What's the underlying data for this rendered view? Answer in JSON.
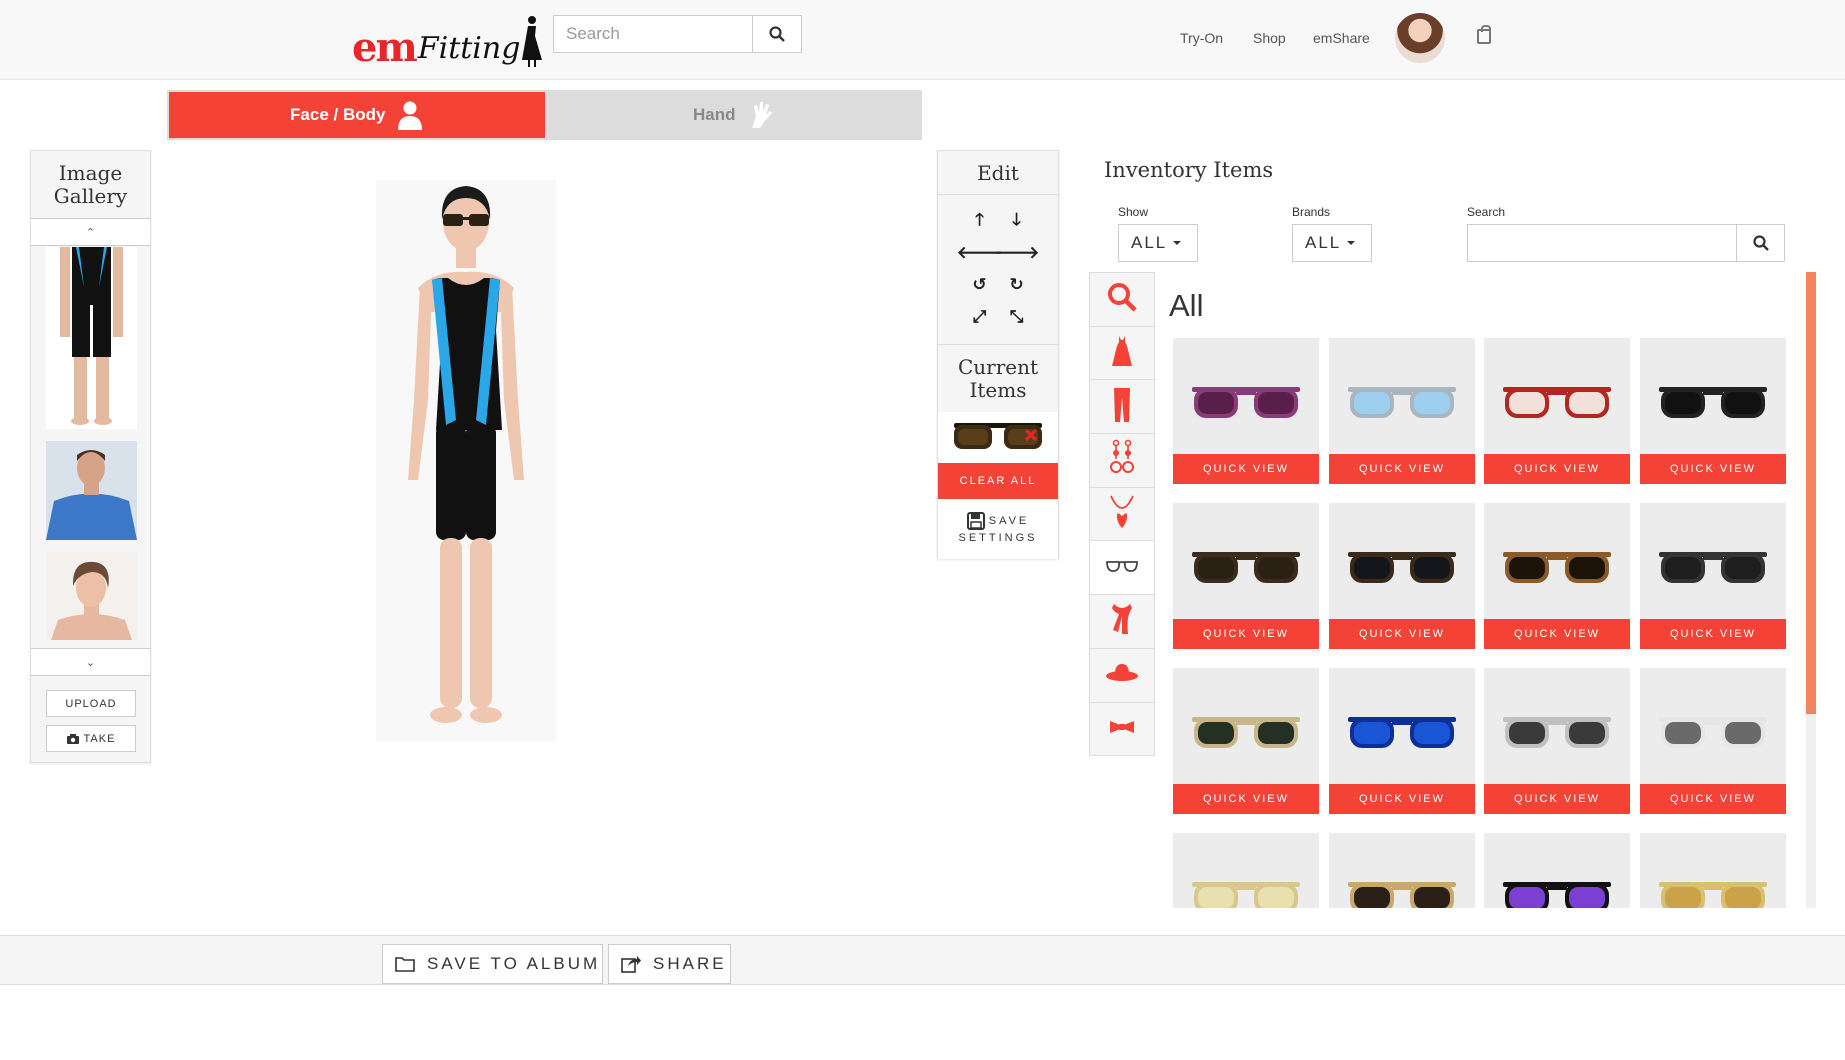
{
  "header": {
    "logo_em": "em",
    "logo_fitting": "Fitting",
    "search_placeholder": "Search",
    "nav": [
      "Try-On",
      "Shop",
      "emShare"
    ]
  },
  "mode_tabs": {
    "face_body": "Face / Body",
    "hand": "Hand",
    "active": "face_body"
  },
  "gallery": {
    "title_line1": "Image",
    "title_line2": "Gallery",
    "upload_label": "UPLOAD",
    "take_label": "TAKE"
  },
  "edit": {
    "title": "Edit",
    "current_line1": "Current",
    "current_line2": "Items",
    "clear_all": "CLEAR ALL",
    "save_line1": "SAVE",
    "save_line2": "SETTINGS"
  },
  "inventory": {
    "title": "Inventory Items",
    "show_label": "Show",
    "show_value": "ALL",
    "brands_label": "Brands",
    "brands_value": "ALL",
    "search_label": "Search",
    "heading": "All",
    "quick_view": "QUICK VIEW",
    "categories": [
      "search-icon",
      "dress-icon",
      "pants-icon",
      "earrings-icon",
      "necklace-icon",
      "glasses-icon",
      "scarf-icon",
      "hat-icon",
      "bowtie-icon"
    ],
    "selected_category": "glasses-icon",
    "items": [
      {
        "lens": "#5a1e4a",
        "frame": "#8a3a78"
      },
      {
        "lens": "#9fcfee",
        "frame": "#a9b6c0"
      },
      {
        "lens": "#f2e0da",
        "frame": "#b3261e"
      },
      {
        "lens": "#111111",
        "frame": "#222222"
      },
      {
        "lens": "#2a2014",
        "frame": "#3a2c1c"
      },
      {
        "lens": "#15151c",
        "frame": "#3a2a1a"
      },
      {
        "lens": "#1c1408",
        "frame": "#8b5a2b"
      },
      {
        "lens": "#1e1e1e",
        "frame": "#333333"
      },
      {
        "lens": "#233023",
        "frame": "#c9b58a"
      },
      {
        "lens": "#1a55d6",
        "frame": "#0d2f9a"
      },
      {
        "lens": "#3a3a3a",
        "frame": "#c0c0c0"
      },
      {
        "lens": "#6a6a6a",
        "frame": "#e6e6e6"
      },
      {
        "lens": "#e9e0b0",
        "frame": "#d8c98a"
      },
      {
        "lens": "#2a2018",
        "frame": "#c9a96a"
      },
      {
        "lens": "#7b3fd1",
        "frame": "#111111"
      },
      {
        "lens": "#c9a24a",
        "frame": "#d8c070"
      }
    ]
  },
  "footer": {
    "save_album": "SAVE TO ALBUM",
    "share": "SHARE"
  },
  "colors": {
    "accent": "#f44336",
    "scroll_thumb": "#f4845f"
  }
}
